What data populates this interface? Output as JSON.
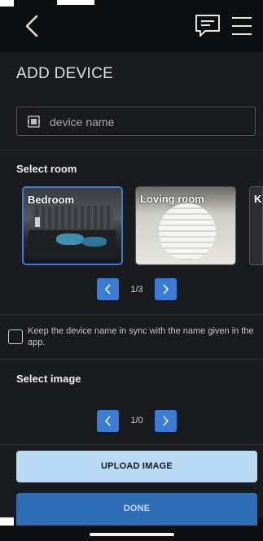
{
  "header": {
    "back_icon": "chevron-left-icon",
    "feedback_icon": "chat-icon",
    "menu_icon": "hamburger-menu-icon"
  },
  "page": {
    "title": "ADD DEVICE"
  },
  "device_name": {
    "placeholder": "device name",
    "value": "",
    "icon": "device-icon"
  },
  "room_section": {
    "label": "Select room",
    "rooms": [
      {
        "label": "Bedroom",
        "selected": true
      },
      {
        "label": "Loving room",
        "selected": false
      },
      {
        "label": "K",
        "selected": false
      }
    ],
    "pager": {
      "text": "1/3",
      "prev_icon": "chevron-left-icon",
      "next_icon": "chevron-right-icon"
    }
  },
  "sync": {
    "checked": false,
    "text": "Keep the device name in sync with the name given in the app."
  },
  "image_section": {
    "label": "Select image",
    "pager": {
      "text": "1/0",
      "prev_icon": "chevron-left-icon",
      "next_icon": "chevron-right-icon"
    }
  },
  "actions": {
    "upload_label": "UPLOAD IMAGE",
    "done_label": "DONE"
  },
  "colors": {
    "accent": "#3a7bd5",
    "upload_bg": "#b9d9f3",
    "done_bg": "#2f6db4",
    "background": "#1a1b1e"
  }
}
